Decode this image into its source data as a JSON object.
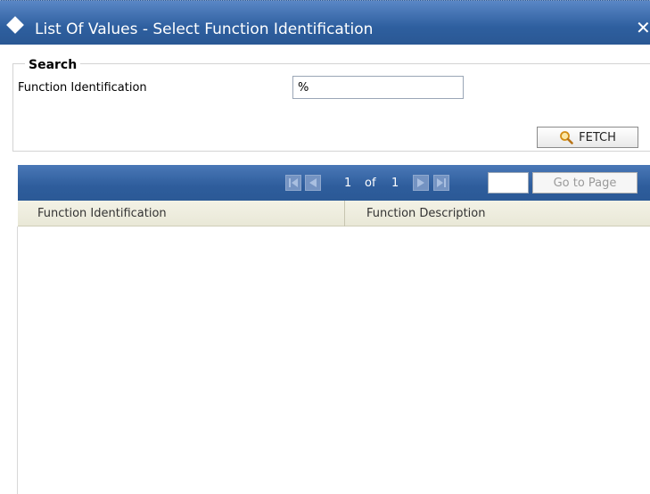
{
  "window": {
    "title": "List Of Values - Select Function Identification",
    "close_icon": "close-icon",
    "title_icon": "diamond-icon"
  },
  "search": {
    "legend": "Search",
    "field_label": "Function Identification",
    "field_value": "%",
    "fetch_label": "FETCH",
    "fetch_icon": "magnifier-icon"
  },
  "pager": {
    "current_page": "1",
    "of_label": "of",
    "total_pages": "1",
    "page_input_value": "",
    "goto_label": "Go to Page",
    "icons": [
      "first-page-icon",
      "previous-page-icon",
      "next-page-icon",
      "last-page-icon"
    ]
  },
  "table": {
    "columns": [
      "Function Identification",
      "Function Description"
    ],
    "rows": []
  },
  "colors": {
    "titlebar": "#2e5f9f",
    "pager_bar": "#2e5d9c",
    "header_row": "#efeedf",
    "accent_icon": "#e2a42a"
  }
}
